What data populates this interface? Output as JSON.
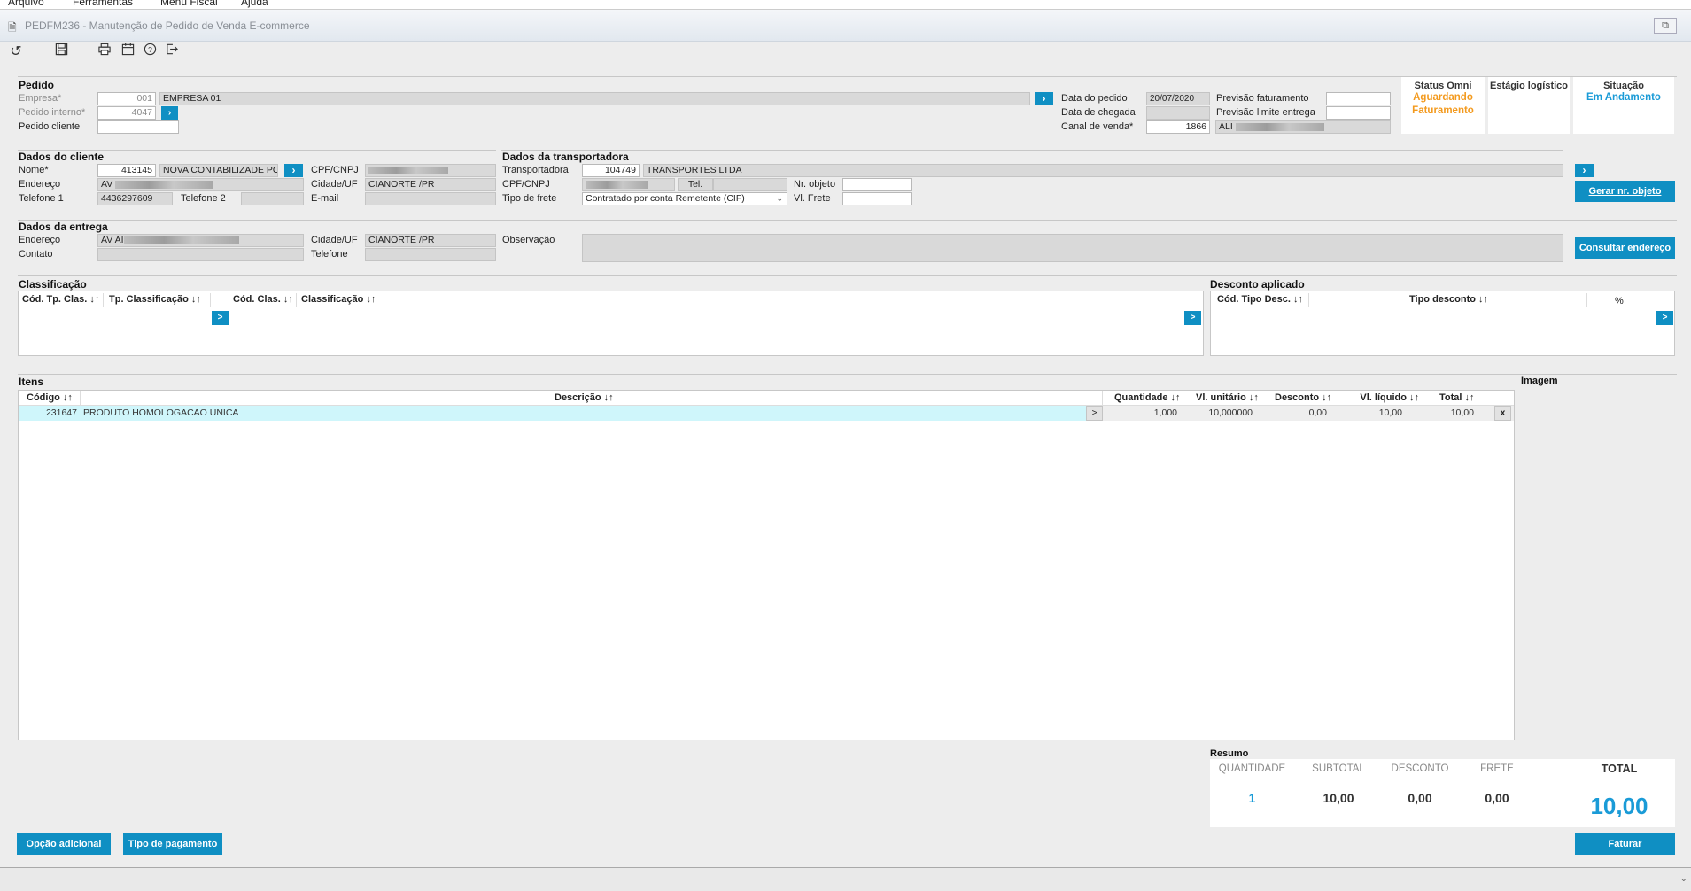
{
  "menu": [
    "Arquivo",
    "Ferramentas",
    "Menu Fiscal",
    "Ajuda"
  ],
  "window": {
    "title": "PEDFM236 - Manutenção de Pedido de Venda E-commerce"
  },
  "pedido": {
    "title": "Pedido",
    "empresa_label": "Empresa*",
    "empresa_code": "001",
    "empresa_name": "EMPRESA 01",
    "pedido_interno_label": "Pedido interno*",
    "pedido_interno": "4047",
    "pedido_cliente_label": "Pedido cliente",
    "pedido_cliente": "",
    "data_pedido_label": "Data do pedido",
    "data_pedido": "20/07/2020",
    "data_chegada_label": "Data de chegada",
    "data_chegada": "",
    "canal_venda_label": "Canal de venda*",
    "canal_venda_code": "1866",
    "canal_venda_name": "ALI",
    "previsao_fat_label": "Previsão faturamento",
    "previsao_fat": "",
    "previsao_entrega_label": "Previsão limite entrega",
    "previsao_entrega": ""
  },
  "status": {
    "omni_title": "Status Omni",
    "omni_line1": "Aguardando",
    "omni_line2": "Faturamento",
    "estagio_title": "Estágio logístico",
    "situacao_title": "Situação",
    "situacao_value": "Em Andamento",
    "orange": "#f39a1e",
    "blue": "#1a9bd7"
  },
  "cliente": {
    "title": "Dados do cliente",
    "nome_label": "Nome*",
    "nome_code": "413145",
    "nome_value": "NOVA CONTABILIZADE PO",
    "endereco_label": "Endereço",
    "endereco_value": "AV",
    "telefone1_label": "Telefone 1",
    "telefone1": "4436297609",
    "telefone2_label": "Telefone 2",
    "telefone2": "",
    "cpf_label": "CPF/CNPJ",
    "cidade_label": "Cidade/UF",
    "cidade_value": "CIANORTE /PR",
    "email_label": "E-mail",
    "email": ""
  },
  "transportadora": {
    "title": "Dados da transportadora",
    "transp_label": "Transportadora",
    "transp_code": "104749",
    "transp_name": "TRANSPORTES LTDA",
    "cpf_label": "CPF/CNPJ",
    "tel_label": "Tel.",
    "frete_label": "Tipo de frete",
    "frete_value": "Contratado por conta Remetente (CIF)",
    "nr_objeto_label": "Nr. objeto",
    "vl_frete_label": "Vl. Frete",
    "gerar_btn": "Gerar nr. objeto"
  },
  "entrega": {
    "title": "Dados da entrega",
    "endereco_label": "Endereço",
    "endereco_value": "AV AI",
    "contato_label": "Contato",
    "cidade_label": "Cidade/UF",
    "cidade_value": "CIANORTE /PR",
    "telefone_label": "Telefone",
    "obs_label": "Observação",
    "consultar_btn": "Consultar endereço"
  },
  "classificacao": {
    "title": "Classificação",
    "columns": [
      "Cód. Tp. Clas. ↓↑",
      "Tp. Classificação ↓↑",
      "Cód. Clas. ↓↑",
      "Classificação ↓↑"
    ],
    "nav": ">"
  },
  "desconto": {
    "title": "Desconto aplicado",
    "columns": [
      "Cód. Tipo Desc. ↓↑",
      "Tipo desconto ↓↑",
      "%"
    ],
    "nav": ">"
  },
  "itens": {
    "title": "Itens",
    "imagem_title": "Imagem",
    "columns": [
      "Código ↓↑",
      "Descrição ↓↑",
      "Quantidade ↓↑",
      "Vl. unitário ↓↑",
      "Desconto ↓↑",
      "Vl. líquido ↓↑",
      "Total ↓↑"
    ],
    "rows": [
      {
        "codigo": "231647",
        "descricao": "PRODUTO HOMOLOGACAO UNICA",
        "btn": ">",
        "quantidade": "1,000",
        "vl_unitario": "10,000000",
        "desconto": "0,00",
        "vl_liquido": "10,00",
        "total": "10,00",
        "remove": "x"
      }
    ]
  },
  "resumo": {
    "title": "Resumo",
    "quantidade_label": "QUANTIDADE",
    "quantidade": "1",
    "subtotal_label": "SUBTOTAL",
    "subtotal": "10,00",
    "desconto_label": "DESCONTO",
    "desconto": "0,00",
    "frete_label": "FRETE",
    "frete": "0,00",
    "total_label": "TOTAL",
    "total": "10,00"
  },
  "buttons": {
    "opcao_adicional": "Opção adicional",
    "tipo_pagamento": "Tipo de pagamento",
    "faturar": "Faturar"
  }
}
